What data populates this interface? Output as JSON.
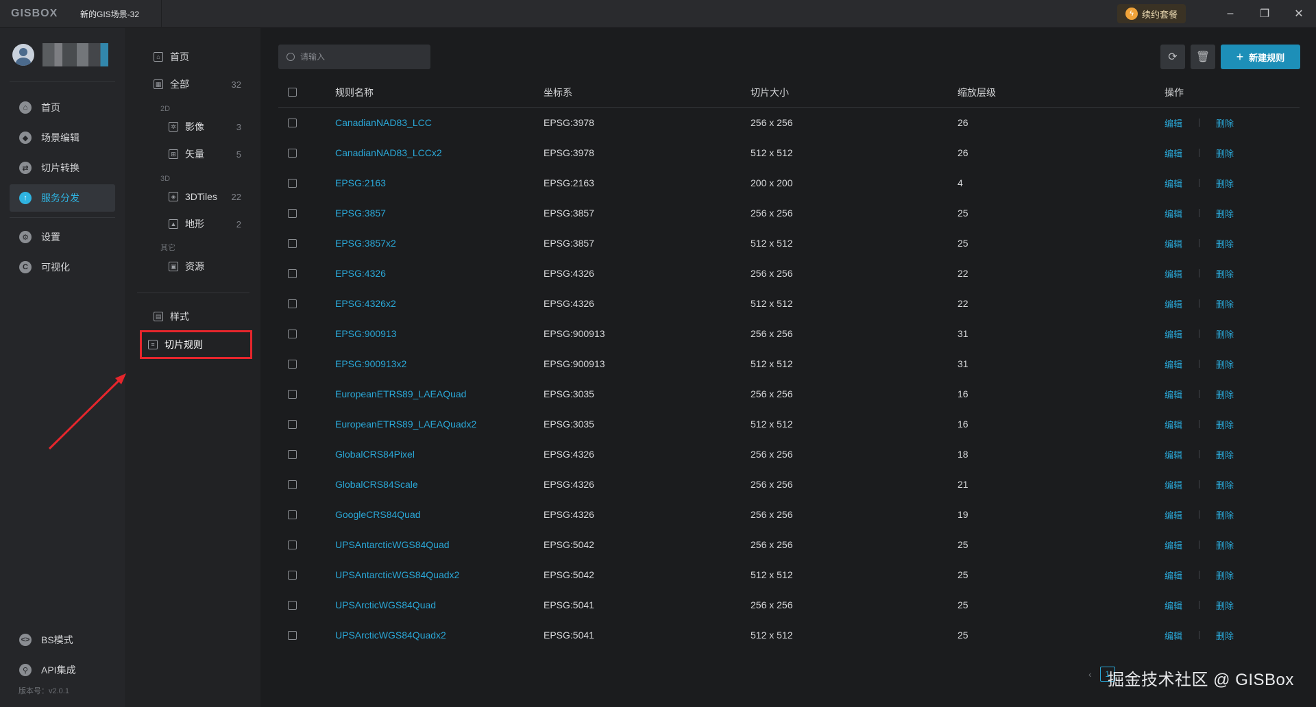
{
  "titlebar": {
    "logo": "GISBOX",
    "scene_tab": "新的GIS场景-32",
    "renew_label": "续约套餐",
    "minimize": "–",
    "restore": "❐",
    "close": "✕"
  },
  "nav": {
    "items": [
      {
        "label": "首页",
        "icon": "home-icon",
        "glyph": "⌂"
      },
      {
        "label": "场景编辑",
        "icon": "cube-icon",
        "glyph": "◆"
      },
      {
        "label": "切片转换",
        "icon": "convert-icon",
        "glyph": "⇄"
      },
      {
        "label": "服务分发",
        "icon": "upload-icon",
        "glyph": "↑"
      }
    ],
    "items2": [
      {
        "label": "设置",
        "icon": "gear-icon",
        "glyph": "⚙"
      },
      {
        "label": "可视化",
        "icon": "visual-icon",
        "glyph": "C"
      }
    ],
    "bottom": [
      {
        "label": "BS模式",
        "icon": "code-icon",
        "glyph": "<>"
      },
      {
        "label": "API集成",
        "icon": "api-icon",
        "glyph": "⚲"
      }
    ],
    "version": "版本号：v2.0.1"
  },
  "panel2": {
    "home": "首页",
    "all": {
      "label": "全部",
      "count": "32"
    },
    "group_2d": "2D",
    "imagery": {
      "label": "影像",
      "count": "3"
    },
    "vector": {
      "label": "矢量",
      "count": "5"
    },
    "group_3d": "3D",
    "tiles3d": {
      "label": "3DTiles",
      "count": "22"
    },
    "terrain": {
      "label": "地形",
      "count": "2"
    },
    "group_other": "其它",
    "resource": "资源",
    "style": "样式",
    "tile_rules": "切片规则"
  },
  "toolbar": {
    "search_placeholder": "请输入",
    "new_rule": "新建规则"
  },
  "table": {
    "headers": {
      "name": "规则名称",
      "crs": "坐标系",
      "size": "切片大小",
      "zoom": "缩放层级",
      "ops": "操作"
    },
    "edit_label": "编辑",
    "delete_label": "删除",
    "rows": [
      {
        "name": "CanadianNAD83_LCC",
        "crs": "EPSG:3978",
        "size": "256 x 256",
        "zoom": "26"
      },
      {
        "name": "CanadianNAD83_LCCx2",
        "crs": "EPSG:3978",
        "size": "512 x 512",
        "zoom": "26"
      },
      {
        "name": "EPSG:2163",
        "crs": "EPSG:2163",
        "size": "200 x 200",
        "zoom": "4"
      },
      {
        "name": "EPSG:3857",
        "crs": "EPSG:3857",
        "size": "256 x 256",
        "zoom": "25"
      },
      {
        "name": "EPSG:3857x2",
        "crs": "EPSG:3857",
        "size": "512 x 512",
        "zoom": "25"
      },
      {
        "name": "EPSG:4326",
        "crs": "EPSG:4326",
        "size": "256 x 256",
        "zoom": "22"
      },
      {
        "name": "EPSG:4326x2",
        "crs": "EPSG:4326",
        "size": "512 x 512",
        "zoom": "22"
      },
      {
        "name": "EPSG:900913",
        "crs": "EPSG:900913",
        "size": "256 x 256",
        "zoom": "31"
      },
      {
        "name": "EPSG:900913x2",
        "crs": "EPSG:900913",
        "size": "512 x 512",
        "zoom": "31"
      },
      {
        "name": "EuropeanETRS89_LAEAQuad",
        "crs": "EPSG:3035",
        "size": "256 x 256",
        "zoom": "16"
      },
      {
        "name": "EuropeanETRS89_LAEAQuadx2",
        "crs": "EPSG:3035",
        "size": "512 x 512",
        "zoom": "16"
      },
      {
        "name": "GlobalCRS84Pixel",
        "crs": "EPSG:4326",
        "size": "256 x 256",
        "zoom": "18"
      },
      {
        "name": "GlobalCRS84Scale",
        "crs": "EPSG:4326",
        "size": "256 x 256",
        "zoom": "21"
      },
      {
        "name": "GoogleCRS84Quad",
        "crs": "EPSG:4326",
        "size": "256 x 256",
        "zoom": "19"
      },
      {
        "name": "UPSAntarcticWGS84Quad",
        "crs": "EPSG:5042",
        "size": "256 x 256",
        "zoom": "25"
      },
      {
        "name": "UPSAntarcticWGS84Quadx2",
        "crs": "EPSG:5042",
        "size": "512 x 512",
        "zoom": "25"
      },
      {
        "name": "UPSArcticWGS84Quad",
        "crs": "EPSG:5041",
        "size": "256 x 256",
        "zoom": "25"
      },
      {
        "name": "UPSArcticWGS84Quadx2",
        "crs": "EPSG:5041",
        "size": "512 x 512",
        "zoom": "25"
      }
    ]
  },
  "pager": {
    "prev": "‹",
    "current": "1"
  },
  "watermark": "掘金技术社区 @ GISBox",
  "colors": {
    "accent": "#2aa8d8",
    "primary_button": "#1d8fb8",
    "highlight_box": "#e6262c"
  }
}
